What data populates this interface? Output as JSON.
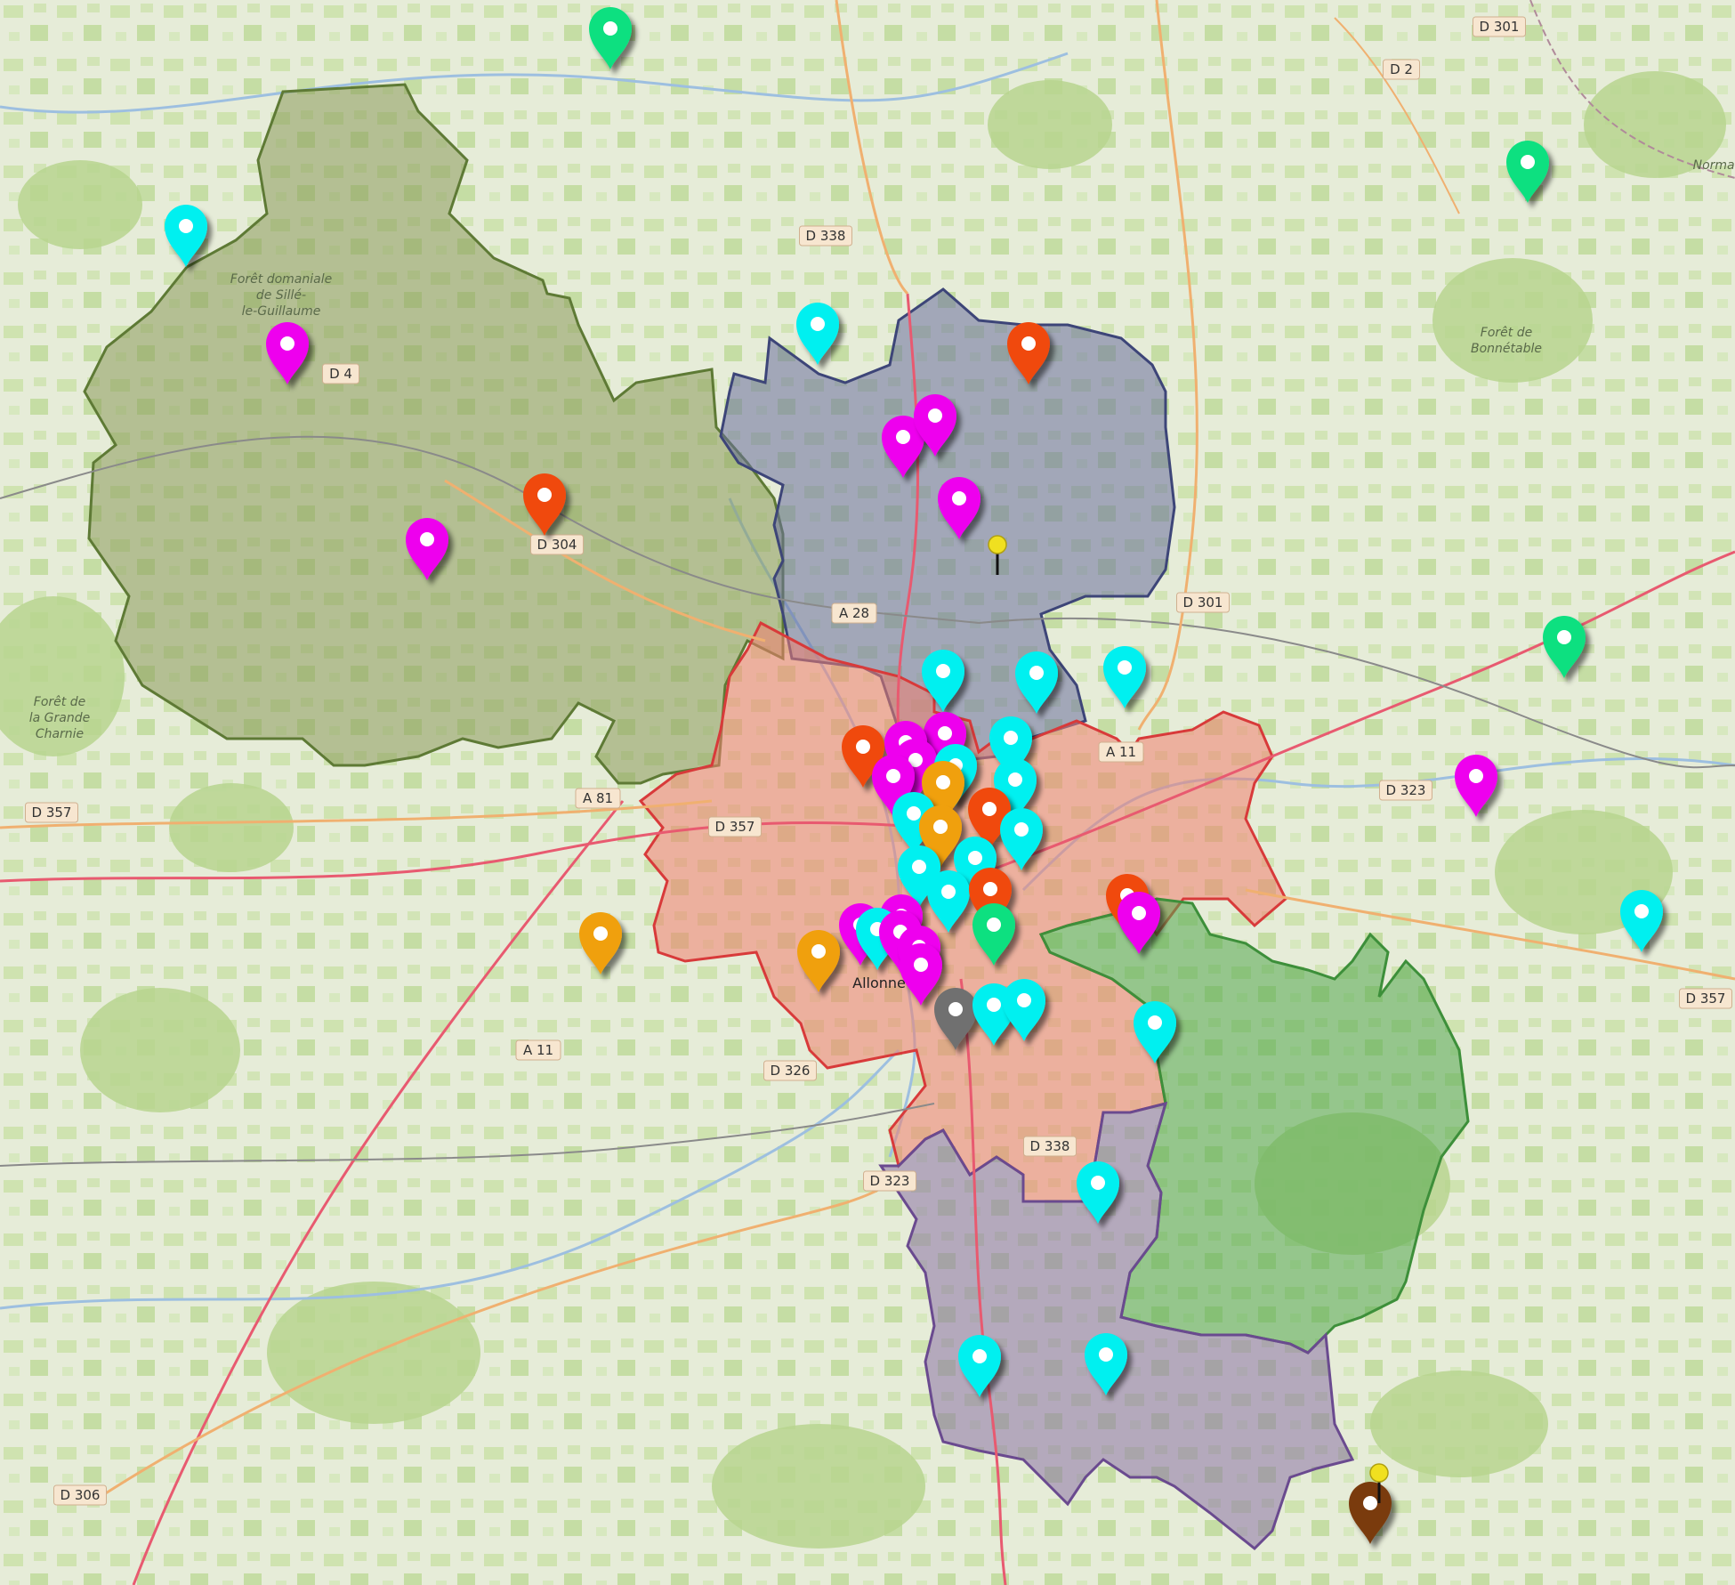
{
  "map": {
    "road_labels": [
      {
        "text": "D 301"
      },
      {
        "text": "D 2"
      },
      {
        "text": "D 338"
      },
      {
        "text": "D 4"
      },
      {
        "text": "D 304"
      },
      {
        "text": "D 301"
      },
      {
        "text": "A 28"
      },
      {
        "text": "A 11"
      },
      {
        "text": "D 323"
      },
      {
        "text": "A 81"
      },
      {
        "text": "D 357"
      },
      {
        "text": "D 357"
      },
      {
        "text": "D 357"
      },
      {
        "text": "A 11"
      },
      {
        "text": "D 326"
      },
      {
        "text": "D 338"
      },
      {
        "text": "D 323"
      },
      {
        "text": "D 306"
      }
    ],
    "place_labels": [
      {
        "lines": [
          "Forêt domaniale",
          "de Sillé-",
          "le-Guillaume"
        ]
      },
      {
        "lines": [
          "Forêt de",
          "la Grande",
          "Charnie"
        ]
      },
      {
        "lines": [
          "Forêt de",
          "Bonnétable"
        ]
      },
      {
        "lines": [
          "Normand"
        ]
      }
    ],
    "town_labels": [
      {
        "text": "Allonne"
      }
    ],
    "regions": [
      {
        "name": "olive",
        "fill": "#8b9a5b",
        "stroke": "#5e7a35"
      },
      {
        "name": "slate",
        "fill": "#6a6f9e",
        "stroke": "#3d4578"
      },
      {
        "name": "red",
        "fill": "#f08070",
        "stroke": "#d83a3a"
      },
      {
        "name": "green",
        "fill": "#52a84e",
        "stroke": "#3d8f3a"
      },
      {
        "name": "purple",
        "fill": "#8a72a6",
        "stroke": "#6a4a8f"
      }
    ],
    "marker_colors": {
      "magenta": "#ee00ee",
      "cyan": "#00f0f0",
      "red": "#f04a10",
      "green": "#10e080",
      "orange": "#f0a010",
      "grey": "#707070",
      "brown": "#7a3a10",
      "yellow": "#f0e020"
    },
    "markers": [
      {
        "color": "green",
        "icon": "map-pin-icon"
      },
      {
        "color": "cyan",
        "icon": "map-pin-icon"
      },
      {
        "color": "green",
        "icon": "map-pin-icon"
      },
      {
        "color": "magenta",
        "icon": "map-pin-icon"
      },
      {
        "color": "cyan",
        "icon": "map-pin-icon"
      },
      {
        "color": "red",
        "icon": "map-pin-icon"
      },
      {
        "color": "red",
        "icon": "map-pin-icon"
      },
      {
        "color": "magenta",
        "icon": "map-pin-icon"
      },
      {
        "color": "magenta",
        "icon": "map-pin-icon"
      },
      {
        "color": "magenta",
        "icon": "map-pin-icon"
      },
      {
        "color": "magenta",
        "icon": "map-pin-icon"
      },
      {
        "color": "cyan",
        "icon": "map-pin-icon"
      },
      {
        "color": "green",
        "icon": "map-pin-icon"
      },
      {
        "color": "cyan",
        "icon": "map-pin-icon"
      },
      {
        "color": "cyan",
        "icon": "map-pin-icon"
      },
      {
        "color": "cyan",
        "icon": "map-pin-icon"
      },
      {
        "color": "magenta",
        "icon": "map-pin-icon"
      },
      {
        "color": "red",
        "icon": "map-pin-icon"
      },
      {
        "color": "magenta",
        "icon": "map-pin-icon"
      },
      {
        "color": "magenta",
        "icon": "map-pin-icon"
      },
      {
        "color": "magenta",
        "icon": "map-pin-icon"
      },
      {
        "color": "cyan",
        "icon": "map-pin-icon"
      },
      {
        "color": "cyan",
        "icon": "map-pin-icon"
      },
      {
        "color": "orange",
        "icon": "map-pin-icon"
      },
      {
        "color": "red",
        "icon": "map-pin-icon"
      },
      {
        "color": "cyan",
        "icon": "map-pin-icon"
      },
      {
        "color": "orange",
        "icon": "map-pin-icon"
      },
      {
        "color": "cyan",
        "icon": "map-pin-icon"
      },
      {
        "color": "cyan",
        "icon": "map-pin-icon"
      },
      {
        "color": "cyan",
        "icon": "map-pin-icon"
      },
      {
        "color": "cyan",
        "icon": "map-pin-icon"
      },
      {
        "color": "red",
        "icon": "map-pin-icon"
      },
      {
        "color": "green",
        "icon": "map-pin-icon"
      },
      {
        "color": "red",
        "icon": "map-pin-icon"
      },
      {
        "color": "magenta",
        "icon": "map-pin-icon"
      },
      {
        "color": "magenta",
        "icon": "map-pin-icon"
      },
      {
        "color": "magenta",
        "icon": "map-pin-icon"
      },
      {
        "color": "cyan",
        "icon": "map-pin-icon"
      },
      {
        "color": "magenta",
        "icon": "map-pin-icon"
      },
      {
        "color": "magenta",
        "icon": "map-pin-icon"
      },
      {
        "color": "orange",
        "icon": "map-pin-icon"
      },
      {
        "color": "orange",
        "icon": "map-pin-icon"
      },
      {
        "color": "magenta",
        "icon": "map-pin-icon"
      },
      {
        "color": "grey",
        "icon": "map-pin-icon"
      },
      {
        "color": "cyan",
        "icon": "map-pin-icon"
      },
      {
        "color": "cyan",
        "icon": "map-pin-icon"
      },
      {
        "color": "cyan",
        "icon": "map-pin-icon"
      },
      {
        "color": "magenta",
        "icon": "map-pin-icon"
      },
      {
        "color": "cyan",
        "icon": "map-pin-icon"
      },
      {
        "color": "cyan",
        "icon": "map-pin-icon"
      },
      {
        "color": "cyan",
        "icon": "map-pin-icon"
      },
      {
        "color": "cyan",
        "icon": "map-pin-icon"
      },
      {
        "color": "brown",
        "icon": "map-pin-icon"
      }
    ],
    "pushpins": [
      {
        "color": "yellow",
        "icon": "pushpin-icon"
      },
      {
        "color": "yellow",
        "icon": "pushpin-icon"
      }
    ]
  }
}
